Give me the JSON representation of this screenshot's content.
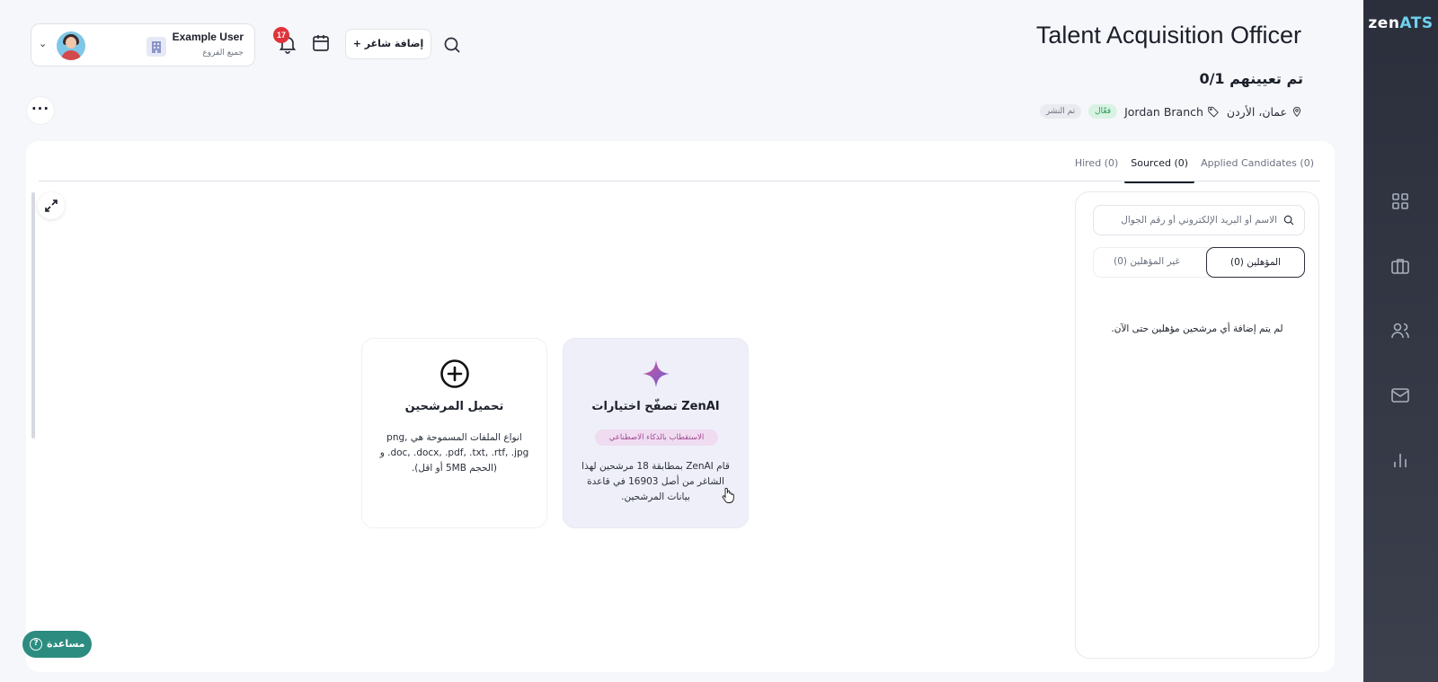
{
  "app": {
    "logo_main": "zen",
    "logo_accent": "ATS"
  },
  "rail": {
    "items": [
      "grid-icon",
      "briefcase-icon",
      "users-icon",
      "mail-icon",
      "bar-chart-icon"
    ]
  },
  "user": {
    "name": "Example User",
    "branch": "جميع الفروع"
  },
  "header": {
    "notifications_count": "17",
    "add_job_label": "+ إضافة شاغر"
  },
  "job": {
    "title": "Talent Acquisition Officer",
    "hired_count": "0/1 تم تعيينهم",
    "location": "عمان، الأردن",
    "branch": "Jordan Branch",
    "status_active": "فعّال",
    "status_published": "تم النشر"
  },
  "tabs": [
    {
      "label": "Applied Candidates (0)",
      "selected": false
    },
    {
      "label": "Sourced (0)",
      "selected": true
    },
    {
      "label": "Hired (0)",
      "selected": false
    }
  ],
  "cards": {
    "zenai": {
      "title": "تصفّح اختيارات ZenAI",
      "pill": "الاستقطاب بالذكاء الاصطناعي",
      "description": "قام ZenAI بمطابقة 18 مرشحين لهذا الشاغر من أصل 16903 في قاعدة بيانات المرشحين."
    },
    "upload": {
      "title": "تحميل المرشحين",
      "description": "انواع الملفات المسموحة هي png, .doc, .docx, .pdf, .txt, .rtf, .jpg و (الحجم 5MB أو اقل)."
    }
  },
  "side_panel": {
    "search_placeholder": "الاسم أو البريد الإلكتروني أو رقم الجوال",
    "qualified_label": "المؤهلين (0)",
    "unqualified_label": "غير المؤهلين (0)",
    "empty_message": "لم يتم إضافة أي مرشحين مؤهلين حتى الآن."
  },
  "help": {
    "label": "مساعدة"
  },
  "colors": {
    "rail": "#2b2f3c",
    "accent_teal": "#2c8c80",
    "badge_red": "#e0333a",
    "ai_pink": "#a1488f"
  }
}
